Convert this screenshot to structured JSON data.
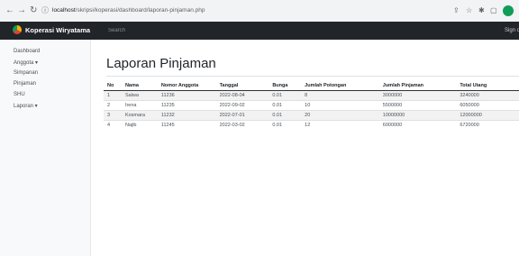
{
  "browser": {
    "url_host": "localhost",
    "url_path": "/skripsi/koperasi/dashboard/laporan-pinjaman.php"
  },
  "navbar": {
    "brand": "Koperasi Wiryatama",
    "search_placeholder": "Search",
    "signout": "Sign out"
  },
  "sidebar": {
    "items": [
      {
        "label": "Dashboard"
      },
      {
        "label": "Anggota ▾"
      },
      {
        "label": "Simpanan"
      },
      {
        "label": "Pinjaman"
      },
      {
        "label": "SHU"
      },
      {
        "label": "Laporan ▾"
      }
    ]
  },
  "main": {
    "title": "Laporan Pinjaman",
    "columns": [
      "No",
      "Nama",
      "Nomor Anggota",
      "Tanggal",
      "Bunga",
      "Jumlah Potongan",
      "Jumlah Pinjaman",
      "Total Utang"
    ],
    "rows": [
      [
        "1",
        "Salwa",
        "11236",
        "2022-08-04",
        "0.01",
        "8",
        "3000000",
        "3240000"
      ],
      [
        "2",
        "Irena",
        "11235",
        "2022-09-02",
        "0.01",
        "10",
        "5500000",
        "6050000"
      ],
      [
        "3",
        "Kosmara",
        "11232",
        "2022-07-01",
        "0.01",
        "20",
        "10000000",
        "12000000"
      ],
      [
        "4",
        "Najib",
        "11245",
        "2022-03-02",
        "0.01",
        "12",
        "6000000",
        "6720000"
      ]
    ]
  }
}
